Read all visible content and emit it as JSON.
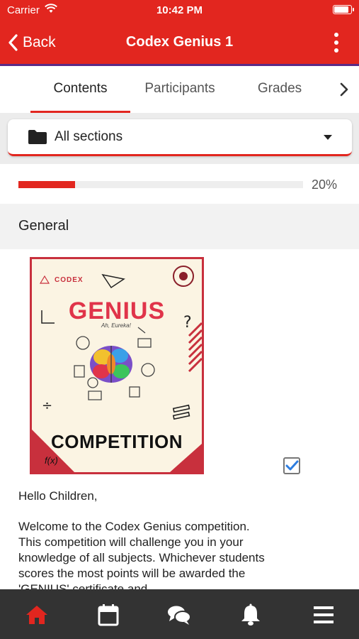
{
  "status_bar": {
    "carrier": "Carrier",
    "time": "10:42 PM"
  },
  "header": {
    "back_label": "Back",
    "title": "Codex Genius 1",
    "accent_color": "#e2261f",
    "underline_color": "#5b2a86"
  },
  "tabs": [
    {
      "label": "Contents",
      "active": true
    },
    {
      "label": "Participants",
      "active": false
    },
    {
      "label": "Grades",
      "active": false
    }
  ],
  "section_selector": {
    "selected": "All sections"
  },
  "progress": {
    "percent": 20,
    "label": "20%"
  },
  "section": {
    "title": "General"
  },
  "poster": {
    "logo_text": "CODEX",
    "headline": "GENIUS",
    "footer": "COMPETITION",
    "formula": "f(x)",
    "scribble": "Ah, Eureka!"
  },
  "completion": {
    "checked": true
  },
  "content": {
    "greeting": "Hello Children,",
    "paragraph": "Welcome to the Codex Genius competition. This competition will challenge you in your knowledge of all subjects. Whichever students scores the most points will be awarded the 'GENIUS' certificate and"
  },
  "bottom_nav": [
    {
      "icon": "home-icon",
      "active": true
    },
    {
      "icon": "calendar-icon",
      "active": false
    },
    {
      "icon": "chat-icon",
      "active": false
    },
    {
      "icon": "bell-icon",
      "active": false
    },
    {
      "icon": "menu-icon",
      "active": false
    }
  ]
}
